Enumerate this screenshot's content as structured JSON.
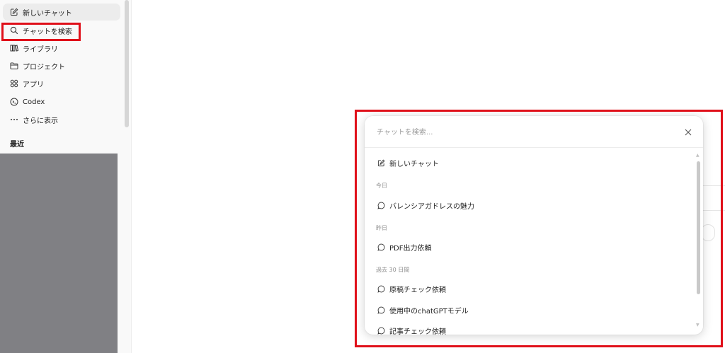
{
  "sidebar": {
    "items": [
      {
        "label": "新しいチャット",
        "icon": "compose-icon"
      },
      {
        "label": "チャットを検索",
        "icon": "search-icon"
      },
      {
        "label": "ライブラリ",
        "icon": "library-icon"
      },
      {
        "label": "プロジェクト",
        "icon": "folder-icon"
      },
      {
        "label": "アプリ",
        "icon": "apps-icon"
      },
      {
        "label": "Codex",
        "icon": "codex-icon"
      },
      {
        "label": "さらに表示",
        "icon": "more-icon"
      }
    ],
    "recent_heading": "最近"
  },
  "search_modal": {
    "placeholder": "チャットを検索...",
    "new_chat_label": "新しいチャット",
    "sections": [
      {
        "label": "今日",
        "items": [
          "バレンシアガドレスの魅力"
        ]
      },
      {
        "label": "昨日",
        "items": [
          "PDF出力依頼"
        ]
      },
      {
        "label": "過去 30 日間",
        "items": [
          "原稿チェック依頼",
          "使用中のchatGPTモデル",
          "記事チェック依頼"
        ]
      }
    ]
  },
  "colors": {
    "highlight": "#e0101a",
    "sidebar_bg": "#f9f9f9",
    "redacted": "#808084"
  }
}
